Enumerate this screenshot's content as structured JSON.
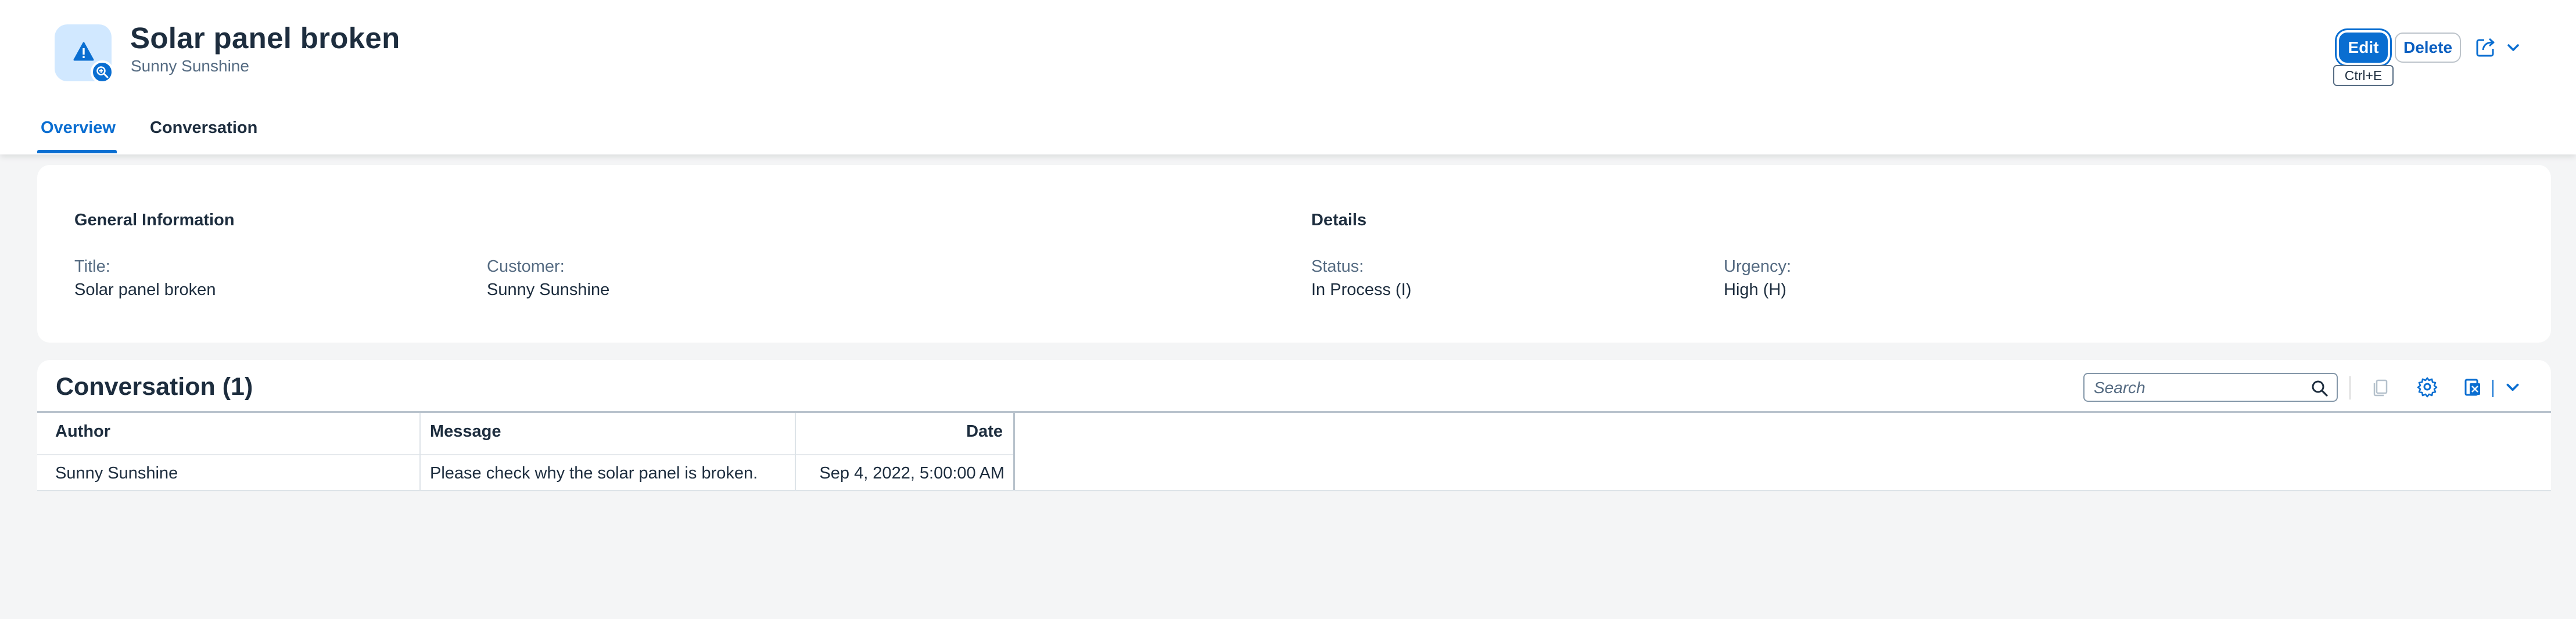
{
  "header": {
    "title": "Solar panel broken",
    "subtitle": "Sunny Sunshine",
    "object_icon": "warning-icon",
    "object_badge_icon": "zoom-in-icon",
    "actions": {
      "edit_label": "Edit",
      "edit_tooltip": "Ctrl+E",
      "delete_label": "Delete",
      "share_icon": "share-icon",
      "more_icon": "chevron-down-icon"
    }
  },
  "tabs": [
    {
      "label": "Overview",
      "selected": true
    },
    {
      "label": "Conversation",
      "selected": false
    }
  ],
  "general_information": {
    "heading": "General Information",
    "fields": [
      {
        "label": "Title:",
        "value": "Solar panel broken"
      },
      {
        "label": "Customer:",
        "value": "Sunny Sunshine"
      }
    ]
  },
  "details": {
    "heading": "Details",
    "fields": [
      {
        "label": "Status:",
        "value": "In Process (I)"
      },
      {
        "label": "Urgency:",
        "value": "High (H)"
      }
    ]
  },
  "conversation": {
    "title": "Conversation (1)",
    "search_placeholder": "Search",
    "toolbar_icons": [
      "copy-icon",
      "settings-icon",
      "export-icon",
      "chevron-down-icon"
    ],
    "columns": [
      "Author",
      "Message",
      "Date"
    ],
    "rows": [
      {
        "author": "Sunny Sunshine",
        "message": "Please check why the solar panel is broken.",
        "date": "Sep 4, 2022, 5:00:00 AM"
      }
    ]
  },
  "colors": {
    "accent": "#0a6ed1",
    "background": "#f4f5f6",
    "text": "#1d2d3e",
    "secondary_text": "#556b82"
  }
}
